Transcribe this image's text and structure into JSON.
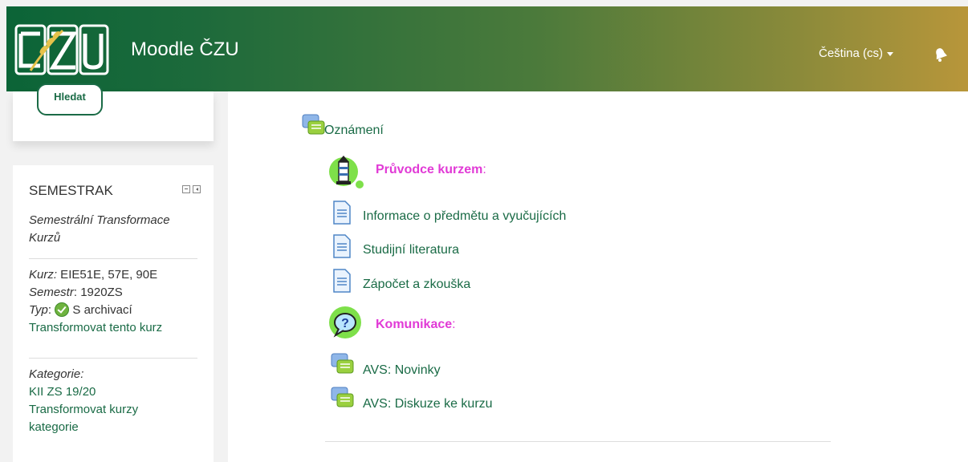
{
  "header": {
    "site_name": "Moodle ČZU",
    "language": "Čeština (cs)"
  },
  "sidebar": {
    "search_button": "Hledat",
    "block": {
      "title": "SEMESTRAK",
      "subtitle_line1": "Semestrální Transformace",
      "subtitle_line2": "Kurzů",
      "course_label": "Kurz:",
      "course_value": " EIE51E, 57E, 90E",
      "semester_label": "Semestr",
      "semester_value": ": 1920ZS",
      "type_label": "Typ",
      "type_value": "S archivací",
      "transform_course_link": "Transformovat tento kurz",
      "category_label": "Kategorie:",
      "category_link": "KII ZS 19/20",
      "transform_category_link_line1": "Transformovat kurzy",
      "transform_category_link_line2": "kategorie"
    }
  },
  "main": {
    "announcements": "Oznámení",
    "guide_label": "Průvodce kurzem",
    "guide_items": [
      "Informace o předmětu a vyučujících",
      "Studijní literatura",
      "Zápočet a zkouška"
    ],
    "communication_label": "Komunikace",
    "forums": [
      "AVS: Novinky",
      "AVS: Diskuze ke kurzu"
    ]
  },
  "icons": {
    "forum": "forum-icon",
    "page": "page-icon",
    "lighthouse": "lighthouse-icon",
    "help": "question-bubble-icon",
    "bell": "bell-icon"
  }
}
